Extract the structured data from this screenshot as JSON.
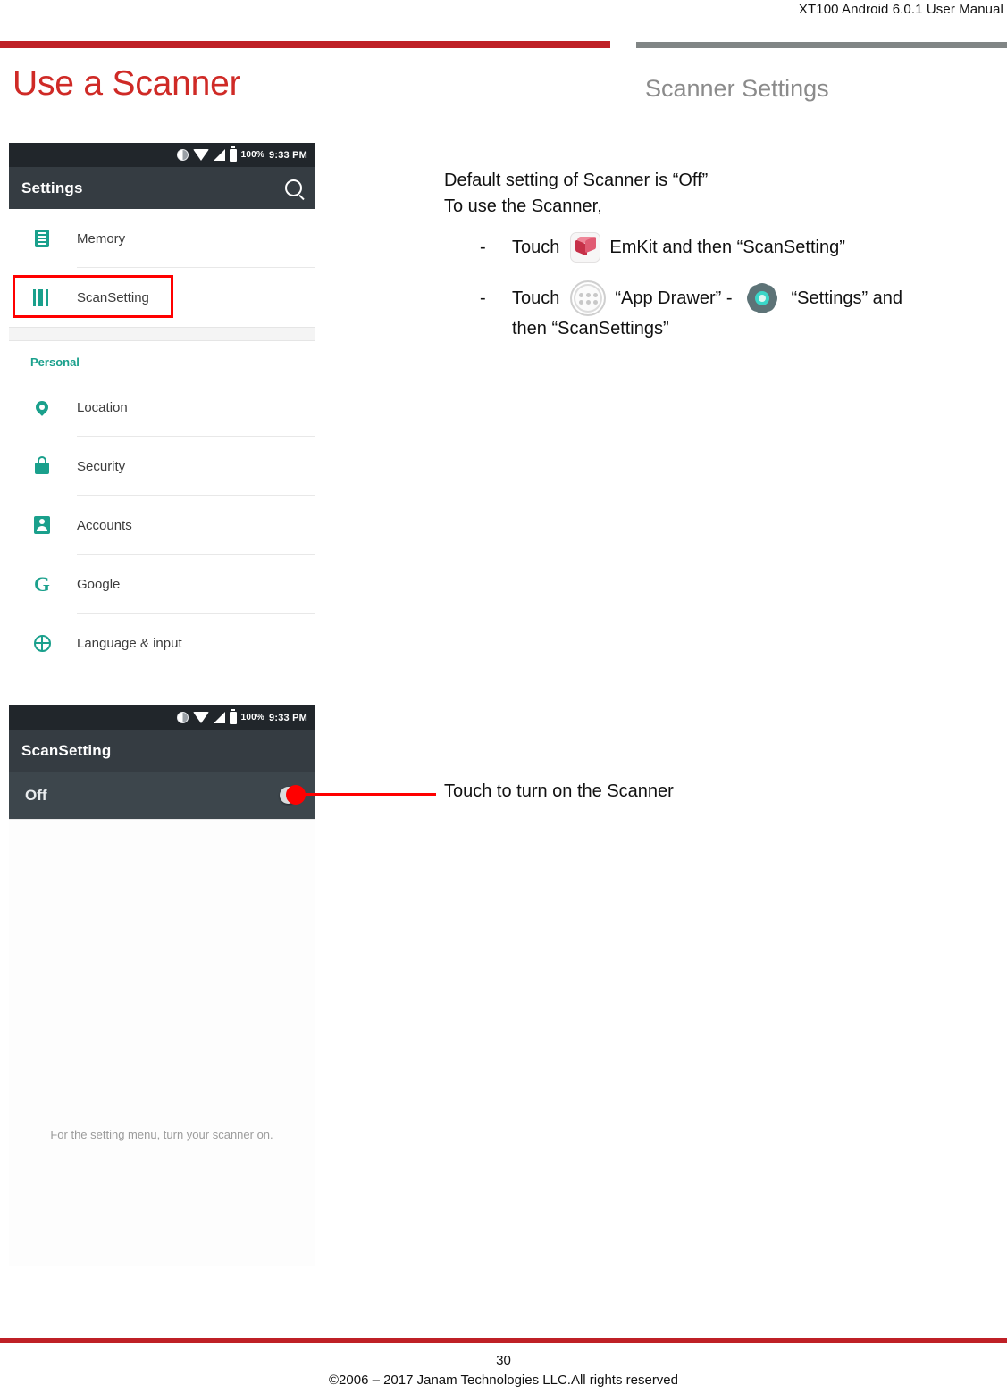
{
  "document": {
    "header_title": "XT100 Android 6.0.1 User Manual",
    "page_title": "Use a Scanner",
    "section_title": "Scanner Settings",
    "accent_red": "#bf2026",
    "accent_gray": "#808585",
    "title_red": "#cf2a26",
    "annotation_red": "#ff0000",
    "android_teal": "#1aa08c"
  },
  "instructions": {
    "line1": "Default setting of Scanner is “Off”",
    "line2": "To use the Scanner,",
    "bullet1": {
      "dash": "-",
      "touch": "Touch",
      "icon": "emkit-app-icon",
      "tail": "EmKit and then “ScanSetting”"
    },
    "bullet2": {
      "dash": "-",
      "touch": "Touch",
      "icon_drawer": "app-drawer-icon",
      "mid": "“App Drawer” -",
      "icon_gear": "settings-gear-icon",
      "tail": "“Settings” and",
      "line2": "then “ScanSettings”"
    }
  },
  "callout": {
    "text": "Touch to turn on the Scanner"
  },
  "screenshot_settings": {
    "statusbar": {
      "brightness_icon": "brightness-icon",
      "wifi_icon": "wifi-icon",
      "signal_icon": "cellular-signal-icon",
      "battery_icon": "battery-full-icon",
      "battery_percent": "100%",
      "clock": "9:33 PM"
    },
    "appbar": {
      "title": "Settings",
      "search_icon": "search-icon"
    },
    "rows_top": [
      {
        "icon": "memory-icon",
        "label": "Memory"
      },
      {
        "icon": "barcode-scansetting-icon",
        "label": "ScanSetting",
        "highlighted": true
      }
    ],
    "section_label": "Personal",
    "rows_personal": [
      {
        "icon": "location-pin-icon",
        "label": "Location"
      },
      {
        "icon": "lock-icon",
        "label": "Security"
      },
      {
        "icon": "account-person-icon",
        "label": "Accounts"
      },
      {
        "icon": "google-g-icon",
        "label": "Google"
      },
      {
        "icon": "globe-icon",
        "label": "Language & input"
      }
    ]
  },
  "screenshot_scansetting": {
    "statusbar": {
      "brightness_icon": "brightness-icon",
      "wifi_icon": "wifi-icon",
      "signal_icon": "cellular-signal-icon",
      "battery_icon": "battery-full-icon",
      "battery_percent": "100%",
      "clock": "9:33 PM"
    },
    "appbar": {
      "title": "ScanSetting"
    },
    "toggle": {
      "label": "Off",
      "state": "off"
    },
    "empty_message": "For the setting menu, turn your scanner on."
  },
  "footer": {
    "page_number": "30",
    "copyright": "©2006 – 2017 Janam Technologies LLC.All rights reserved"
  }
}
